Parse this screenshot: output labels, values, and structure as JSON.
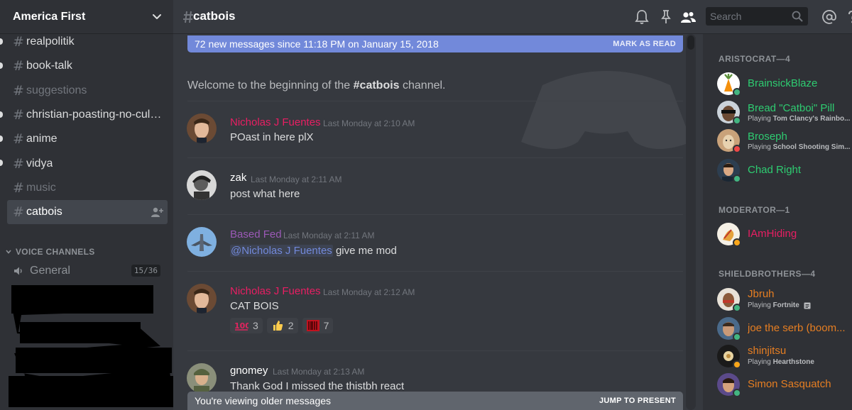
{
  "server": {
    "name": "America First"
  },
  "channels": [
    {
      "name": "realpolitik",
      "unread": true,
      "muted": false,
      "active": false
    },
    {
      "name": "book-talk",
      "unread": true,
      "muted": false,
      "active": false
    },
    {
      "name": "suggestions",
      "unread": false,
      "muted": true,
      "active": false
    },
    {
      "name": "christian-poasting-no-cult...",
      "unread": true,
      "muted": false,
      "active": false
    },
    {
      "name": "anime",
      "unread": true,
      "muted": false,
      "active": false
    },
    {
      "name": "vidya",
      "unread": true,
      "muted": false,
      "active": false
    },
    {
      "name": "music",
      "unread": false,
      "muted": true,
      "active": false
    },
    {
      "name": "catbois",
      "unread": false,
      "muted": false,
      "active": true
    }
  ],
  "voice": {
    "category": "VOICE CHANNELS",
    "channels": [
      {
        "name": "General",
        "count": "15/36"
      }
    ]
  },
  "chat": {
    "channel": "catbois",
    "search_placeholder": "Search",
    "new_banner": {
      "text": "72 new messages since 11:18 PM on January 15, 2018",
      "action": "MARK AS READ"
    },
    "welcome_prefix": "Welcome to the beginning of the ",
    "welcome_channel": "#catbois",
    "welcome_suffix": " channel.",
    "messages": [
      {
        "author": "Nicholas J Fuentes",
        "color": "#e91e63",
        "time": "Last Monday at 2:10 AM",
        "text": "POast in here plX"
      },
      {
        "author": "zak",
        "color": "#ffffff",
        "time": "Last Monday at 2:11 AM",
        "text": "post what here"
      },
      {
        "author": "Based Fed",
        "color": "#9b59b6",
        "time": "Last Monday at 2:11 AM",
        "mention": "@Nicholas J Fuentes",
        "text": " give me mod"
      },
      {
        "author": "Nicholas J Fuentes",
        "color": "#e91e63",
        "time": "Last Monday at 2:12 AM",
        "text": "CAT BOIS",
        "reactions": [
          {
            "emoji": "hundred-points",
            "count": "3"
          },
          {
            "emoji": "thumbs-up",
            "count": "2"
          },
          {
            "emoji": "barcode",
            "count": "7"
          }
        ]
      },
      {
        "author": "gnomey",
        "color": "#ffffff",
        "time": "Last Monday at 2:13 AM",
        "text": "Thank God I missed the thistbh react"
      }
    ],
    "old_banner": {
      "text": "You're viewing older messages",
      "action": "JUMP TO PRESENT"
    }
  },
  "members": {
    "groups": [
      {
        "role": "ARISTOCRAT—4",
        "items": [
          {
            "name": "BrainsickBlaze",
            "color": "#2ecc71",
            "status": "online",
            "activity_prefix": "",
            "activity": ""
          },
          {
            "name": "Bread \"Catboi\" Pill",
            "color": "#2ecc71",
            "status": "online",
            "activity_prefix": "Playing ",
            "activity": "Tom Clancy's Rainbo..."
          },
          {
            "name": "Broseph",
            "color": "#2ecc71",
            "status": "dnd",
            "activity_prefix": "Playing ",
            "activity": "School Shooting Sim..."
          },
          {
            "name": "Chad Right",
            "color": "#2ecc71",
            "status": "online",
            "activity_prefix": "",
            "activity": ""
          }
        ]
      },
      {
        "role": "MODERATOR—1",
        "items": [
          {
            "name": "IAmHiding",
            "color": "#e91e63",
            "status": "idle",
            "activity_prefix": "",
            "activity": ""
          }
        ]
      },
      {
        "role": "SHIELDBROTHERS—4",
        "items": [
          {
            "name": "Jbruh",
            "color": "#e67e22",
            "status": "online",
            "activity_prefix": "Playing ",
            "activity": "Fortnite"
          },
          {
            "name": "joe the serb (boom...",
            "color": "#e67e22",
            "status": "online",
            "activity_prefix": "",
            "activity": ""
          },
          {
            "name": "shinjitsu",
            "color": "#e67e22",
            "status": "idle",
            "activity_prefix": "Playing ",
            "activity": "Hearthstone"
          },
          {
            "name": "Simon Sasquatch",
            "color": "#e67e22",
            "status": "online",
            "activity_prefix": "",
            "activity": ""
          }
        ]
      }
    ]
  },
  "colors": {
    "online": "#43b581",
    "idle": "#faa61a",
    "dnd": "#f04747",
    "blurple": "#7289da"
  }
}
